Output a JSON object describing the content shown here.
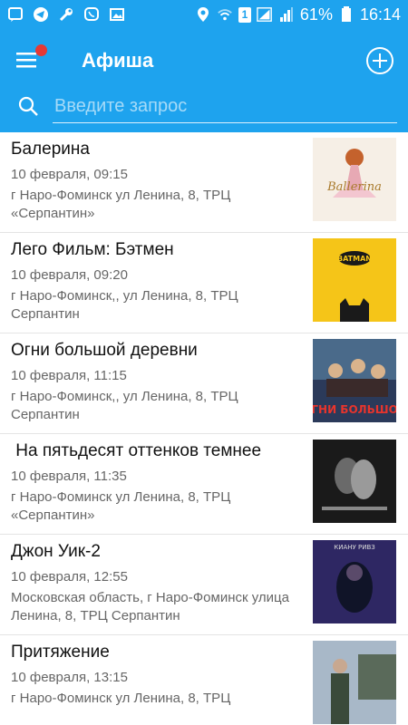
{
  "status_bar": {
    "battery": "61%",
    "time": "16:14",
    "sim": "1"
  },
  "toolbar": {
    "title": "Афиша",
    "search_placeholder": "Введите запрос"
  },
  "events": [
    {
      "title": "Балерина",
      "date": "10 февраля, 09:15",
      "place": "г Наро-Фоминск ул Ленина, 8, ТРЦ «Серпантин»",
      "poster_text": "Ballerina"
    },
    {
      "title": "Лего Фильм: Бэтмен",
      "date": "10 февраля, 09:20",
      "place": "г Наро-Фоминск,, ул Ленина, 8, ТРЦ Серпантин",
      "poster_text": "BATMAN"
    },
    {
      "title": "Огни большой деревни",
      "date": "10 февраля, 11:15",
      "place": "г Наро-Фоминск,, ул Ленина, 8, ТРЦ Серпантин",
      "poster_text": "ОГНИ БОЛЬШОЙ"
    },
    {
      "title": " На пятьдесят оттенков темнее",
      "date": "10 февраля, 11:35",
      "place": "г Наро-Фоминск ул Ленина, 8, ТРЦ «Серпантин»",
      "poster_text": ""
    },
    {
      "title": "Джон Уик-2",
      "date": "10 февраля, 12:55",
      "place": "Московская область, г Наро-Фоминск улица Ленина, 8, ТРЦ Серпантин",
      "poster_text": "КИАНУ РИВЗ"
    },
    {
      "title": "Притяжение",
      "date": "10 февраля, 13:15",
      "place": "г Наро-Фоминск ул Ленина, 8, ТРЦ",
      "poster_text": ""
    }
  ],
  "colors": {
    "accent": "#1ea3ee",
    "badge": "#e53935"
  }
}
